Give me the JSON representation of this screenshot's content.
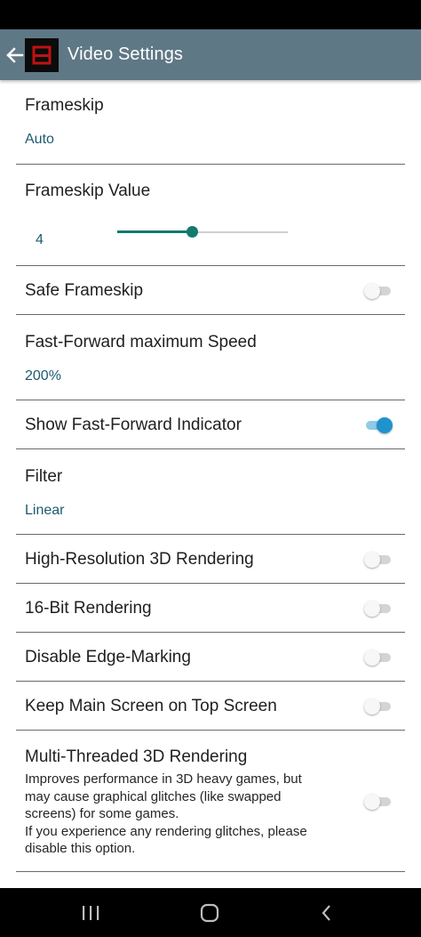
{
  "app_bar": {
    "title": "Video Settings",
    "back_icon": "arrow-left-icon",
    "app_icon": "melonds-app-icon"
  },
  "settings": {
    "frameskip": {
      "title": "Frameskip",
      "value": "Auto"
    },
    "frameskip_value": {
      "title": "Frameskip Value",
      "value": "4",
      "slider_fraction": 0.44
    },
    "safe_frameskip": {
      "title": "Safe Frameskip",
      "enabled": false
    },
    "ff_max_speed": {
      "title": "Fast-Forward maximum Speed",
      "value": "200%"
    },
    "show_ff_indicator": {
      "title": "Show Fast-Forward Indicator",
      "enabled": true
    },
    "filter": {
      "title": "Filter",
      "value": "Linear"
    },
    "high_res_3d": {
      "title": "High-Resolution 3D Rendering",
      "enabled": false
    },
    "bit16_rendering": {
      "title": "16-Bit Rendering",
      "enabled": false
    },
    "disable_edge_marking": {
      "title": "Disable Edge-Marking",
      "enabled": false
    },
    "keep_main_top": {
      "title": "Keep Main Screen on Top Screen",
      "enabled": false
    },
    "multithreaded_3d": {
      "title": "Multi-Threaded 3D Rendering",
      "summary_lines": [
        "Improves performance in 3D heavy games, but",
        "may cause graphical glitches (like swapped",
        "screens) for some games.",
        "If you experience any rendering glitches, please",
        "disable this option."
      ],
      "enabled": false
    }
  },
  "nav_bar": {
    "recents_icon": "recents-icon",
    "home_icon": "home-icon",
    "back_icon": "back-chevron-icon"
  },
  "colors": {
    "app_bar": "#5f7885",
    "accent_value": "#1e5a70",
    "slider": "#137a6e",
    "switch_on": "#1f93cf"
  }
}
